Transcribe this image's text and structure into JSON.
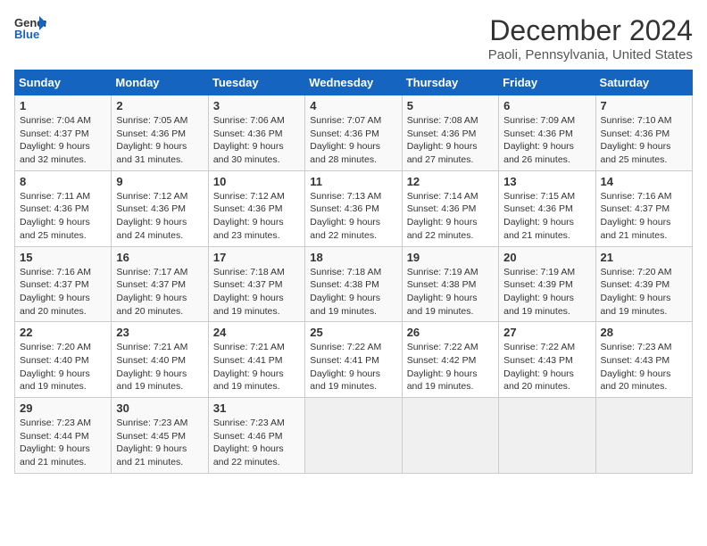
{
  "logo": {
    "line1": "General",
    "line2": "Blue"
  },
  "title": "December 2024",
  "subtitle": "Paoli, Pennsylvania, United States",
  "weekdays": [
    "Sunday",
    "Monday",
    "Tuesday",
    "Wednesday",
    "Thursday",
    "Friday",
    "Saturday"
  ],
  "days": [
    null,
    null,
    {
      "n": 1,
      "sr": "7:04 AM",
      "ss": "4:37 PM",
      "dl": "9 hours and 32 minutes."
    },
    {
      "n": 2,
      "sr": "7:05 AM",
      "ss": "4:36 PM",
      "dl": "9 hours and 31 minutes."
    },
    {
      "n": 3,
      "sr": "7:06 AM",
      "ss": "4:36 PM",
      "dl": "9 hours and 30 minutes."
    },
    {
      "n": 4,
      "sr": "7:07 AM",
      "ss": "4:36 PM",
      "dl": "9 hours and 28 minutes."
    },
    {
      "n": 5,
      "sr": "7:08 AM",
      "ss": "4:36 PM",
      "dl": "9 hours and 27 minutes."
    },
    {
      "n": 6,
      "sr": "7:09 AM",
      "ss": "4:36 PM",
      "dl": "9 hours and 26 minutes."
    },
    {
      "n": 7,
      "sr": "7:10 AM",
      "ss": "4:36 PM",
      "dl": "9 hours and 25 minutes."
    },
    {
      "n": 8,
      "sr": "7:11 AM",
      "ss": "4:36 PM",
      "dl": "9 hours and 25 minutes."
    },
    {
      "n": 9,
      "sr": "7:12 AM",
      "ss": "4:36 PM",
      "dl": "9 hours and 24 minutes."
    },
    {
      "n": 10,
      "sr": "7:12 AM",
      "ss": "4:36 PM",
      "dl": "9 hours and 23 minutes."
    },
    {
      "n": 11,
      "sr": "7:13 AM",
      "ss": "4:36 PM",
      "dl": "9 hours and 22 minutes."
    },
    {
      "n": 12,
      "sr": "7:14 AM",
      "ss": "4:36 PM",
      "dl": "9 hours and 22 minutes."
    },
    {
      "n": 13,
      "sr": "7:15 AM",
      "ss": "4:36 PM",
      "dl": "9 hours and 21 minutes."
    },
    {
      "n": 14,
      "sr": "7:16 AM",
      "ss": "4:37 PM",
      "dl": "9 hours and 21 minutes."
    },
    {
      "n": 15,
      "sr": "7:16 AM",
      "ss": "4:37 PM",
      "dl": "9 hours and 20 minutes."
    },
    {
      "n": 16,
      "sr": "7:17 AM",
      "ss": "4:37 PM",
      "dl": "9 hours and 20 minutes."
    },
    {
      "n": 17,
      "sr": "7:18 AM",
      "ss": "4:37 PM",
      "dl": "9 hours and 19 minutes."
    },
    {
      "n": 18,
      "sr": "7:18 AM",
      "ss": "4:38 PM",
      "dl": "9 hours and 19 minutes."
    },
    {
      "n": 19,
      "sr": "7:19 AM",
      "ss": "4:38 PM",
      "dl": "9 hours and 19 minutes."
    },
    {
      "n": 20,
      "sr": "7:19 AM",
      "ss": "4:39 PM",
      "dl": "9 hours and 19 minutes."
    },
    {
      "n": 21,
      "sr": "7:20 AM",
      "ss": "4:39 PM",
      "dl": "9 hours and 19 minutes."
    },
    {
      "n": 22,
      "sr": "7:20 AM",
      "ss": "4:40 PM",
      "dl": "9 hours and 19 minutes."
    },
    {
      "n": 23,
      "sr": "7:21 AM",
      "ss": "4:40 PM",
      "dl": "9 hours and 19 minutes."
    },
    {
      "n": 24,
      "sr": "7:21 AM",
      "ss": "4:41 PM",
      "dl": "9 hours and 19 minutes."
    },
    {
      "n": 25,
      "sr": "7:22 AM",
      "ss": "4:41 PM",
      "dl": "9 hours and 19 minutes."
    },
    {
      "n": 26,
      "sr": "7:22 AM",
      "ss": "4:42 PM",
      "dl": "9 hours and 19 minutes."
    },
    {
      "n": 27,
      "sr": "7:22 AM",
      "ss": "4:43 PM",
      "dl": "9 hours and 20 minutes."
    },
    {
      "n": 28,
      "sr": "7:23 AM",
      "ss": "4:43 PM",
      "dl": "9 hours and 20 minutes."
    },
    {
      "n": 29,
      "sr": "7:23 AM",
      "ss": "4:44 PM",
      "dl": "9 hours and 21 minutes."
    },
    {
      "n": 30,
      "sr": "7:23 AM",
      "ss": "4:45 PM",
      "dl": "9 hours and 21 minutes."
    },
    {
      "n": 31,
      "sr": "7:23 AM",
      "ss": "4:46 PM",
      "dl": "9 hours and 22 minutes."
    },
    null,
    null,
    null,
    null,
    null
  ]
}
